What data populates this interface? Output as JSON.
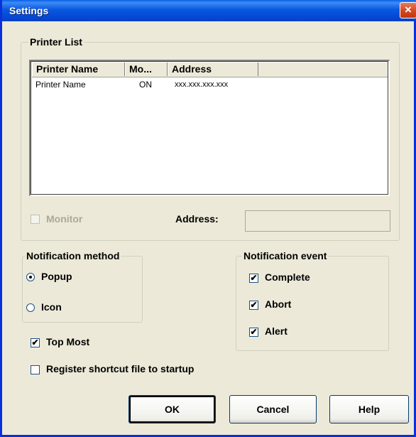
{
  "window": {
    "title": "Settings",
    "close_glyph": "×"
  },
  "printer_list": {
    "legend": "Printer List",
    "columns": [
      "Printer Name",
      "Mo...",
      "Address"
    ],
    "rows": [
      {
        "name": "Printer Name",
        "monitor": "ON",
        "address": "xxx.xxx.xxx.xxx"
      }
    ],
    "monitor_label": "Monitor",
    "monitor_checked": false,
    "address_label": "Address:",
    "address_value": ""
  },
  "notification_method": {
    "legend": "Notification method",
    "options": [
      {
        "label": "Popup",
        "selected": true
      },
      {
        "label": "Icon",
        "selected": false
      }
    ]
  },
  "notification_event": {
    "legend": "Notification event",
    "options": [
      {
        "label": "Complete",
        "checked": true
      },
      {
        "label": "Abort",
        "checked": true
      },
      {
        "label": "Alert",
        "checked": true
      }
    ]
  },
  "options": {
    "top_most_label": "Top Most",
    "top_most_checked": true,
    "register_label": "Register shortcut file to startup",
    "register_checked": false
  },
  "buttons": {
    "ok": "OK",
    "cancel": "Cancel",
    "help": "Help"
  },
  "icons": {
    "checkmark": "✔"
  },
  "colors": {
    "title_bar": "#0a58e0",
    "dialog_bg": "#ece9d8",
    "close_button": "#d4431a"
  }
}
